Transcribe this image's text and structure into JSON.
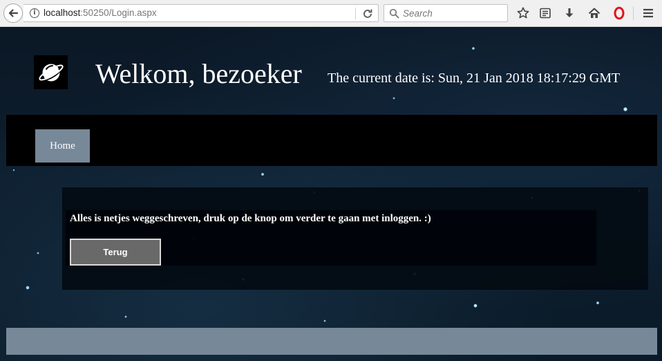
{
  "browser": {
    "url_host": "localhost",
    "url_rest": ":50250/Login.aspx",
    "search_placeholder": "Search",
    "icons": [
      "back-icon",
      "info-icon",
      "reload-icon",
      "search-icon",
      "bookmark-star-icon",
      "reading-list-icon",
      "download-icon",
      "home-icon",
      "opera-icon",
      "menu-icon"
    ],
    "accent_color": "#e0161c"
  },
  "header": {
    "welcome": "Welkom, bezoeker",
    "date": "The current date is: Sun, 21 Jan 2018 18:17:29 GMT",
    "logo_icon": "planet-icon"
  },
  "nav": {
    "items": [
      {
        "label": "Home"
      }
    ],
    "bar_color": "#000000",
    "item_color": "#778899"
  },
  "content": {
    "message": "Alles is netjes weggeschreven, druk op de knop om verder te gaan met inloggen. :)",
    "button_label": "Terug"
  },
  "footer": {
    "color": "#778899"
  }
}
